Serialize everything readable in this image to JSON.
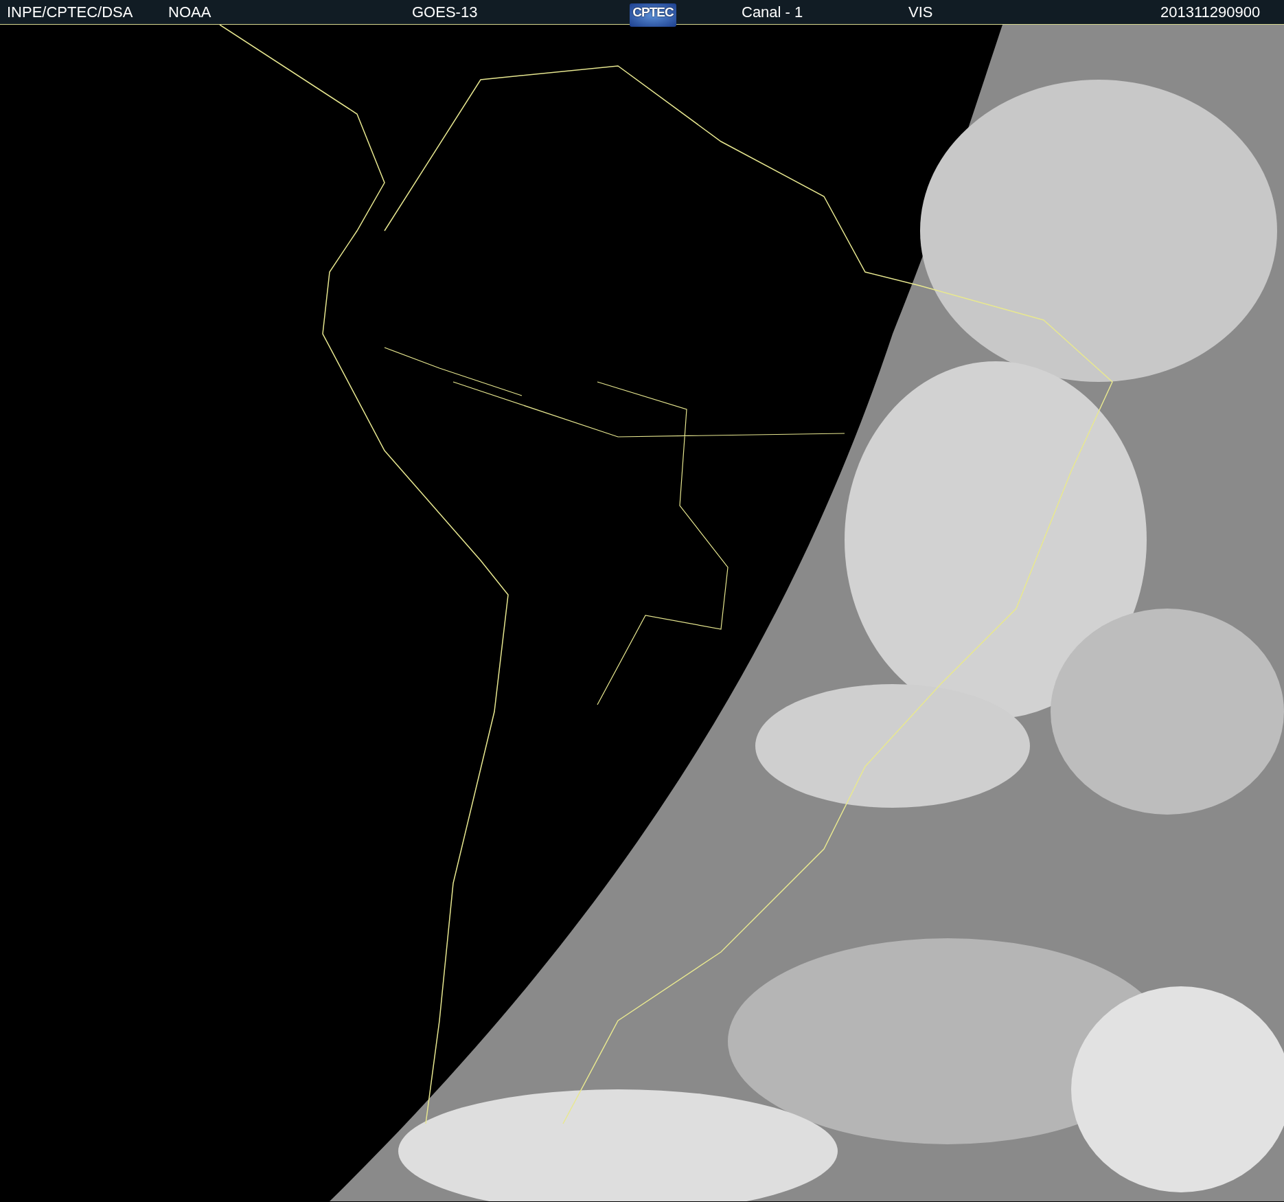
{
  "header": {
    "items": [
      {
        "kind": "text",
        "text": "INPE/CPTEC/DSA"
      },
      {
        "kind": "text",
        "text": "NOAA"
      },
      {
        "kind": "text",
        "text": "GOES-13"
      },
      {
        "kind": "logo",
        "text": "CPTEC"
      },
      {
        "kind": "text",
        "text": "Canal - 1"
      },
      {
        "kind": "text",
        "text": "VIS"
      },
      {
        "kind": "text",
        "text": "201311290900"
      }
    ]
  }
}
